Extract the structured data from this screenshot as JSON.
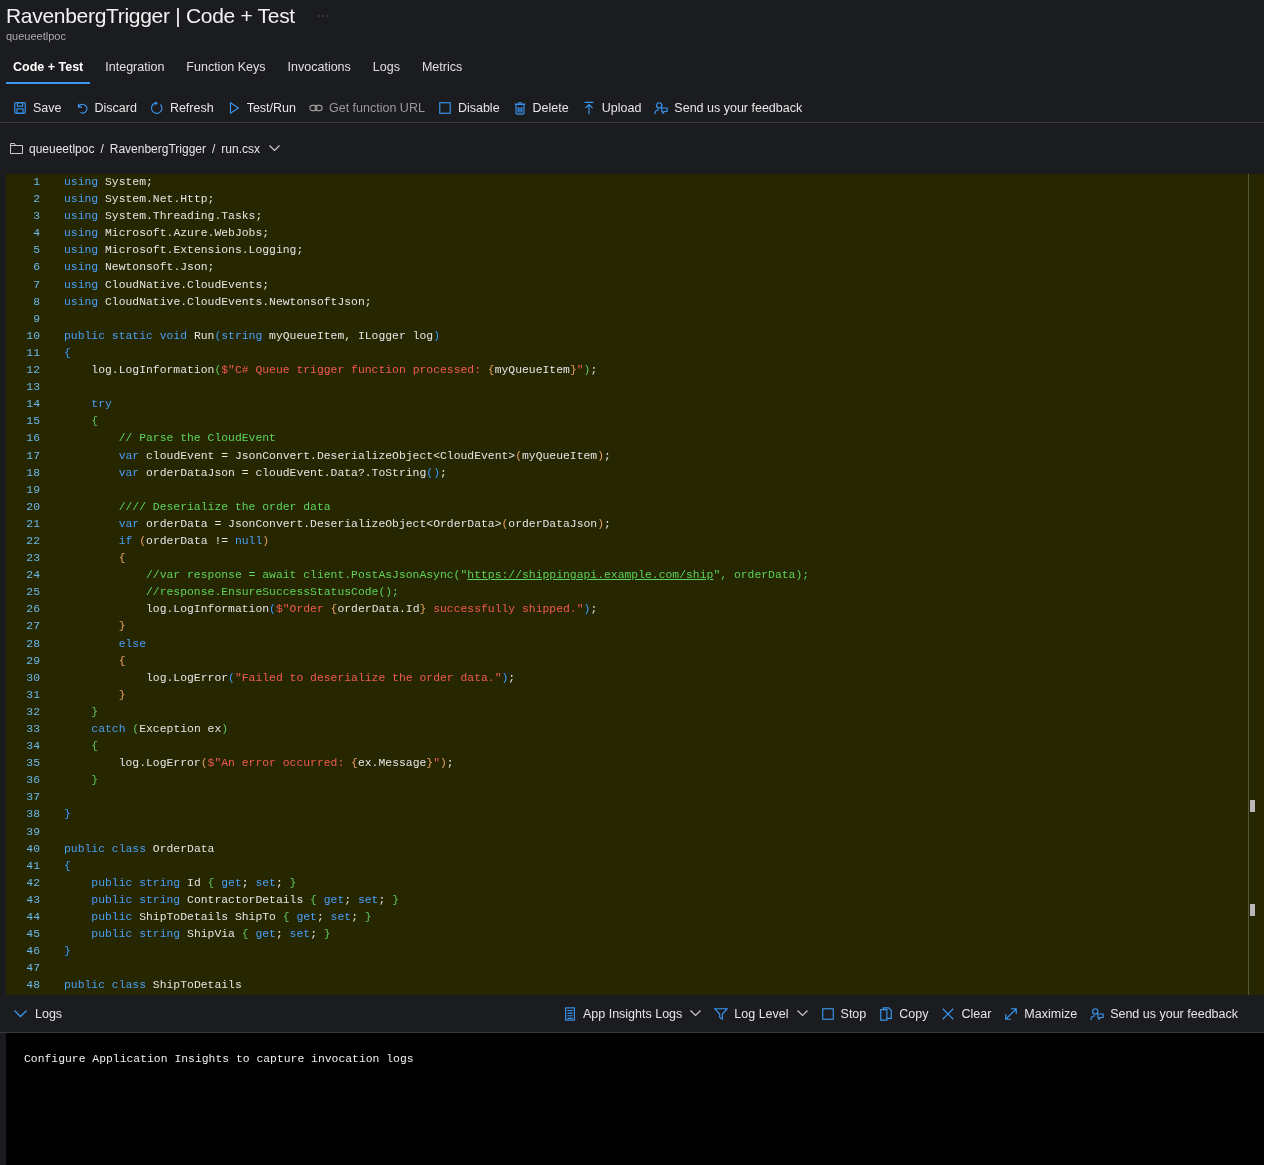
{
  "header": {
    "title": "RavenbergTrigger | Code + Test",
    "subtitle": "queueetlpoc"
  },
  "tabs": [
    {
      "label": "Code + Test",
      "selected": true
    },
    {
      "label": "Integration",
      "selected": false
    },
    {
      "label": "Function Keys",
      "selected": false
    },
    {
      "label": "Invocations",
      "selected": false
    },
    {
      "label": "Logs",
      "selected": false
    },
    {
      "label": "Metrics",
      "selected": false
    }
  ],
  "toolbar": [
    {
      "kind": "save",
      "label": "Save",
      "disabled": false
    },
    {
      "kind": "discard",
      "label": "Discard",
      "disabled": false
    },
    {
      "kind": "refresh",
      "label": "Refresh",
      "disabled": false
    },
    {
      "kind": "run",
      "label": "Test/Run",
      "disabled": false
    },
    {
      "kind": "link",
      "label": "Get function URL",
      "disabled": true
    },
    {
      "kind": "square",
      "label": "Disable",
      "disabled": false
    },
    {
      "kind": "trash",
      "label": "Delete",
      "disabled": false
    },
    {
      "kind": "upload",
      "label": "Upload",
      "disabled": false
    },
    {
      "kind": "feedback",
      "label": "Send us your feedback",
      "disabled": false
    }
  ],
  "breadcrumb": {
    "parts": [
      "queueetlpoc",
      "RavenbergTrigger",
      "run.csx"
    ],
    "separators": [
      "/",
      "/"
    ]
  },
  "editor": {
    "lines": [
      {
        "number": "1",
        "tokens": [
          {
            "kind": "kw",
            "text": "using"
          },
          {
            "kind": "id",
            "text": " System;"
          }
        ]
      },
      {
        "number": "2",
        "tokens": [
          {
            "kind": "kw",
            "text": "using"
          },
          {
            "kind": "id",
            "text": " System.Net.Http;"
          }
        ]
      },
      {
        "number": "3",
        "tokens": [
          {
            "kind": "kw",
            "text": "using"
          },
          {
            "kind": "id",
            "text": " System.Threading.Tasks;"
          }
        ]
      },
      {
        "number": "4",
        "tokens": [
          {
            "kind": "kw",
            "text": "using"
          },
          {
            "kind": "id",
            "text": " Microsoft.Azure.WebJobs;"
          }
        ]
      },
      {
        "number": "5",
        "tokens": [
          {
            "kind": "kw",
            "text": "using"
          },
          {
            "kind": "id",
            "text": " Microsoft.Extensions.Logging;"
          }
        ]
      },
      {
        "number": "6",
        "tokens": [
          {
            "kind": "kw",
            "text": "using"
          },
          {
            "kind": "id",
            "text": " Newtonsoft.Json;"
          }
        ]
      },
      {
        "number": "7",
        "tokens": [
          {
            "kind": "kw",
            "text": "using"
          },
          {
            "kind": "id",
            "text": " CloudNative.CloudEvents;"
          }
        ]
      },
      {
        "number": "8",
        "tokens": [
          {
            "kind": "kw",
            "text": "using"
          },
          {
            "kind": "id",
            "text": " CloudNative.CloudEvents.NewtonsoftJson;"
          }
        ]
      },
      {
        "number": "9"
      },
      {
        "number": "10",
        "tokens": [
          {
            "kind": "kw",
            "text": "public static void"
          },
          {
            "kind": "id",
            "text": " Run"
          },
          {
            "kind": "b1",
            "text": "("
          },
          {
            "kind": "kw",
            "text": "string"
          },
          {
            "kind": "id",
            "text": " myQueueItem, ILogger log"
          },
          {
            "kind": "b1",
            "text": ")"
          }
        ]
      },
      {
        "number": "11",
        "tokens": [
          {
            "kind": "b1",
            "text": "{"
          }
        ]
      },
      {
        "number": "12",
        "tokens": [
          {
            "kind": "id",
            "text": "    log.LogInformation"
          },
          {
            "kind": "b2",
            "text": "("
          },
          {
            "kind": "str",
            "text": "$\"C# Queue trigger function processed: "
          },
          {
            "kind": "b3",
            "text": "{"
          },
          {
            "kind": "id",
            "text": "myQueueItem"
          },
          {
            "kind": "b3",
            "text": "}"
          },
          {
            "kind": "str",
            "text": "\""
          },
          {
            "kind": "b2",
            "text": ")"
          },
          {
            "kind": "id",
            "text": ";"
          }
        ]
      },
      {
        "number": "13"
      },
      {
        "number": "14",
        "tokens": [
          {
            "kind": "kw",
            "text": "    try"
          }
        ]
      },
      {
        "number": "15",
        "tokens": [
          {
            "kind": "b2",
            "text": "    {"
          }
        ]
      },
      {
        "number": "16",
        "tokens": [
          {
            "kind": "cm",
            "text": "        // Parse the CloudEvent"
          }
        ]
      },
      {
        "number": "17",
        "tokens": [
          {
            "kind": "kw",
            "text": "        var"
          },
          {
            "kind": "id",
            "text": " cloudEvent = JsonConvert.DeserializeObject<CloudEvent>"
          },
          {
            "kind": "b3",
            "text": "("
          },
          {
            "kind": "id",
            "text": "myQueueItem"
          },
          {
            "kind": "b3",
            "text": ")"
          },
          {
            "kind": "id",
            "text": ";"
          }
        ]
      },
      {
        "number": "18",
        "tokens": [
          {
            "kind": "kw",
            "text": "        var"
          },
          {
            "kind": "id",
            "text": " orderDataJson = cloudEvent.Data?.ToString"
          },
          {
            "kind": "b1",
            "text": "()"
          },
          {
            "kind": "id",
            "text": ";"
          }
        ]
      },
      {
        "number": "19"
      },
      {
        "number": "20",
        "tokens": [
          {
            "kind": "cm",
            "text": "        //// Deserialize the order data"
          }
        ]
      },
      {
        "number": "21",
        "tokens": [
          {
            "kind": "kw",
            "text": "        var"
          },
          {
            "kind": "id",
            "text": " orderData = JsonConvert.DeserializeObject<OrderData>"
          },
          {
            "kind": "b3",
            "text": "("
          },
          {
            "kind": "id",
            "text": "orderDataJson"
          },
          {
            "kind": "b3",
            "text": ")"
          },
          {
            "kind": "id",
            "text": ";"
          }
        ]
      },
      {
        "number": "22",
        "tokens": [
          {
            "kind": "kw",
            "text": "        if "
          },
          {
            "kind": "b3",
            "text": "("
          },
          {
            "kind": "id",
            "text": "orderData != "
          },
          {
            "kind": "kw",
            "text": "null"
          },
          {
            "kind": "b3",
            "text": ")"
          }
        ]
      },
      {
        "number": "23",
        "tokens": [
          {
            "kind": "b3",
            "text": "        {"
          }
        ]
      },
      {
        "number": "24",
        "tokens": [
          {
            "kind": "cm",
            "text": "            //var response = await client.PostAsJsonAsync(\""
          },
          {
            "kind": "url",
            "text": "https://shippingapi.example.com/ship"
          },
          {
            "kind": "cm",
            "text": "\", orderData);"
          }
        ]
      },
      {
        "number": "25",
        "tokens": [
          {
            "kind": "cm",
            "text": "            //response.EnsureSuccessStatusCode();"
          }
        ]
      },
      {
        "number": "26",
        "tokens": [
          {
            "kind": "id",
            "text": "            log.LogInformation"
          },
          {
            "kind": "b1",
            "text": "("
          },
          {
            "kind": "str",
            "text": "$\"Order "
          },
          {
            "kind": "b3",
            "text": "{"
          },
          {
            "kind": "id",
            "text": "orderData.Id"
          },
          {
            "kind": "b3",
            "text": "}"
          },
          {
            "kind": "str",
            "text": " successfully shipped.\""
          },
          {
            "kind": "b1",
            "text": ")"
          },
          {
            "kind": "id",
            "text": ";"
          }
        ]
      },
      {
        "number": "27",
        "tokens": [
          {
            "kind": "b3",
            "text": "        }"
          }
        ]
      },
      {
        "number": "28",
        "tokens": [
          {
            "kind": "kw",
            "text": "        else"
          }
        ]
      },
      {
        "number": "29",
        "tokens": [
          {
            "kind": "b3",
            "text": "        {"
          }
        ]
      },
      {
        "number": "30",
        "tokens": [
          {
            "kind": "id",
            "text": "            log.LogError"
          },
          {
            "kind": "b1",
            "text": "("
          },
          {
            "kind": "str",
            "text": "\"Failed to deserialize the order data.\""
          },
          {
            "kind": "b1",
            "text": ")"
          },
          {
            "kind": "id",
            "text": ";"
          }
        ]
      },
      {
        "number": "31",
        "tokens": [
          {
            "kind": "b3",
            "text": "        }"
          }
        ]
      },
      {
        "number": "32",
        "tokens": [
          {
            "kind": "b2",
            "text": "    }"
          }
        ]
      },
      {
        "number": "33",
        "tokens": [
          {
            "kind": "kw",
            "text": "    catch "
          },
          {
            "kind": "b2",
            "text": "("
          },
          {
            "kind": "id",
            "text": "Exception ex"
          },
          {
            "kind": "b2",
            "text": ")"
          }
        ]
      },
      {
        "number": "34",
        "tokens": [
          {
            "kind": "b2",
            "text": "    {"
          }
        ]
      },
      {
        "number": "35",
        "tokens": [
          {
            "kind": "id",
            "text": "        log.LogError"
          },
          {
            "kind": "b3",
            "text": "("
          },
          {
            "kind": "str",
            "text": "$\"An error occurred: "
          },
          {
            "kind": "b3",
            "text": "{"
          },
          {
            "kind": "id",
            "text": "ex.Message"
          },
          {
            "kind": "b3",
            "text": "}"
          },
          {
            "kind": "str",
            "text": "\""
          },
          {
            "kind": "b3",
            "text": ")"
          },
          {
            "kind": "id",
            "text": ";"
          }
        ]
      },
      {
        "number": "36",
        "tokens": [
          {
            "kind": "b2",
            "text": "    }"
          }
        ]
      },
      {
        "number": "37"
      },
      {
        "number": "38",
        "tokens": [
          {
            "kind": "b1",
            "text": "}"
          }
        ]
      },
      {
        "number": "39"
      },
      {
        "number": "40",
        "tokens": [
          {
            "kind": "kw",
            "text": "public class"
          },
          {
            "kind": "id",
            "text": " OrderData"
          }
        ]
      },
      {
        "number": "41",
        "tokens": [
          {
            "kind": "b1",
            "text": "{"
          }
        ]
      },
      {
        "number": "42",
        "tokens": [
          {
            "kind": "kw",
            "text": "    public string"
          },
          {
            "kind": "id",
            "text": " Id "
          },
          {
            "kind": "b2",
            "text": "{"
          },
          {
            "kind": "kw",
            "text": " get"
          },
          {
            "kind": "id",
            "text": "; "
          },
          {
            "kind": "kw",
            "text": "set"
          },
          {
            "kind": "id",
            "text": "; "
          },
          {
            "kind": "b2",
            "text": "}"
          }
        ]
      },
      {
        "number": "43",
        "tokens": [
          {
            "kind": "kw",
            "text": "    public string"
          },
          {
            "kind": "id",
            "text": " ContractorDetails "
          },
          {
            "kind": "b2",
            "text": "{"
          },
          {
            "kind": "kw",
            "text": " get"
          },
          {
            "kind": "id",
            "text": "; "
          },
          {
            "kind": "kw",
            "text": "set"
          },
          {
            "kind": "id",
            "text": "; "
          },
          {
            "kind": "b2",
            "text": "}"
          }
        ]
      },
      {
        "number": "44",
        "tokens": [
          {
            "kind": "kw",
            "text": "    public"
          },
          {
            "kind": "id",
            "text": " ShipToDetails ShipTo "
          },
          {
            "kind": "b2",
            "text": "{"
          },
          {
            "kind": "kw",
            "text": " get"
          },
          {
            "kind": "id",
            "text": "; "
          },
          {
            "kind": "kw",
            "text": "set"
          },
          {
            "kind": "id",
            "text": "; "
          },
          {
            "kind": "b2",
            "text": "}"
          }
        ]
      },
      {
        "number": "45",
        "tokens": [
          {
            "kind": "kw",
            "text": "    public string"
          },
          {
            "kind": "id",
            "text": " ShipVia "
          },
          {
            "kind": "b2",
            "text": "{"
          },
          {
            "kind": "kw",
            "text": " get"
          },
          {
            "kind": "id",
            "text": "; "
          },
          {
            "kind": "kw",
            "text": "set"
          },
          {
            "kind": "id",
            "text": "; "
          },
          {
            "kind": "b2",
            "text": "}"
          }
        ]
      },
      {
        "number": "46",
        "tokens": [
          {
            "kind": "b1",
            "text": "}"
          }
        ]
      },
      {
        "number": "47"
      },
      {
        "number": "48",
        "tokens": [
          {
            "kind": "kw",
            "text": "public class"
          },
          {
            "kind": "id",
            "text": " ShipToDetails"
          }
        ]
      }
    ]
  },
  "logs": {
    "label": "Logs",
    "expanded": true,
    "actions": [
      {
        "kind": "list",
        "label": "App Insights Logs",
        "dropdown": true
      },
      {
        "kind": "filter",
        "label": "Log Level",
        "dropdown": true
      },
      {
        "kind": "square",
        "label": "Stop",
        "dropdown": false
      },
      {
        "kind": "copy",
        "label": "Copy",
        "dropdown": false
      },
      {
        "kind": "close",
        "label": "Clear",
        "dropdown": false
      },
      {
        "kind": "maximize",
        "label": "Maximize",
        "dropdown": false
      },
      {
        "kind": "feedback",
        "label": "Send us your feedback",
        "dropdown": false
      }
    ],
    "message": "Configure Application Insights to capture invocation logs"
  }
}
